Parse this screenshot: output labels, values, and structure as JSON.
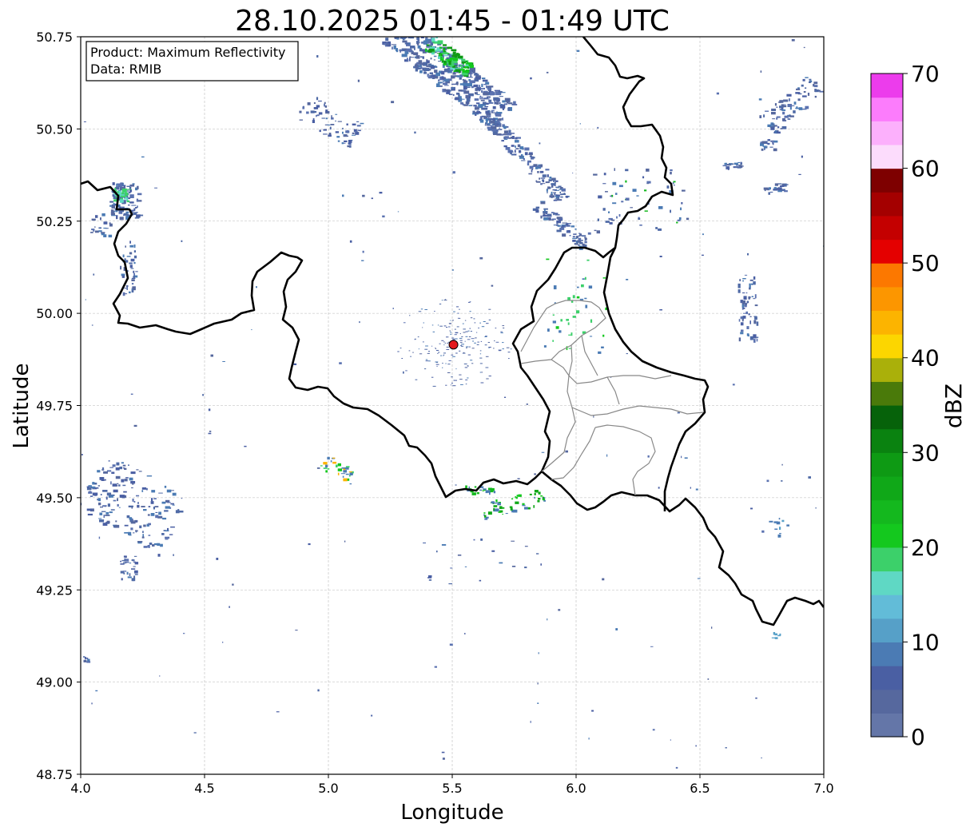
{
  "title": "28.10.2025 01:45 - 01:49 UTC",
  "info_box": {
    "line1": "Product: Maximum Reflectivity",
    "line2": "Data: RMIB"
  },
  "axes": {
    "xlabel": "Longitude",
    "ylabel": "Latitude",
    "xlim": [
      4.0,
      7.0
    ],
    "ylim": [
      48.75,
      50.75
    ],
    "x_ticks": [
      {
        "value": 4.0,
        "label": "4.0"
      },
      {
        "value": 4.5,
        "label": "4.5"
      },
      {
        "value": 5.0,
        "label": "5.0"
      },
      {
        "value": 5.5,
        "label": "5.5"
      },
      {
        "value": 6.0,
        "label": "6.0"
      },
      {
        "value": 6.5,
        "label": "6.5"
      },
      {
        "value": 7.0,
        "label": "7.0"
      }
    ],
    "y_ticks": [
      {
        "value": 48.75,
        "label": "48.75"
      },
      {
        "value": 49.0,
        "label": "49.00"
      },
      {
        "value": 49.25,
        "label": "49.25"
      },
      {
        "value": 49.5,
        "label": "49.50"
      },
      {
        "value": 49.75,
        "label": "49.75"
      },
      {
        "value": 50.0,
        "label": "50.00"
      },
      {
        "value": 50.25,
        "label": "50.25"
      },
      {
        "value": 50.5,
        "label": "50.50"
      },
      {
        "value": 50.75,
        "label": "50.75"
      }
    ],
    "grid": true
  },
  "radar_site": {
    "lon": 5.505,
    "lat": 49.915,
    "color": "#e41a1c"
  },
  "colorbar": {
    "label": "dBZ",
    "min": 0,
    "max": 70,
    "tick_labels": [
      {
        "value": 0,
        "label": "0"
      },
      {
        "value": 10,
        "label": "10"
      },
      {
        "value": 20,
        "label": "20"
      },
      {
        "value": 30,
        "label": "30"
      },
      {
        "value": 40,
        "label": "40"
      },
      {
        "value": 50,
        "label": "50"
      },
      {
        "value": 60,
        "label": "60"
      },
      {
        "value": 70,
        "label": "70"
      }
    ],
    "colors": [
      "#6476a8",
      "#56689e",
      "#4a5fa3",
      "#4b7bb4",
      "#56a0c8",
      "#62bcd8",
      "#5fd8c4",
      "#3cd06a",
      "#14c81e",
      "#14b81e",
      "#10a818",
      "#0e9a14",
      "#0a8210",
      "#06620a",
      "#4a7a0a",
      "#aab00a",
      "#fcd600",
      "#fcb400",
      "#fc9600",
      "#fc7800",
      "#e40000",
      "#c40000",
      "#a40000",
      "#7e0000",
      "#fcdcfc",
      "#fcb0fc",
      "#fc7cfc",
      "#ec3cec"
    ]
  },
  "chart_data": {
    "type": "map",
    "product": "Maximum Reflectivity",
    "source": "RMIB",
    "time_window": "28.10.2025 01:45 - 01:49 UTC",
    "radar_site": {
      "lon": 5.505,
      "lat": 49.915
    },
    "echo_areas": [
      {
        "name": "north-band",
        "lon": [
          5.35,
          5.65
        ],
        "lat": [
          50.45,
          50.75
        ],
        "max_dbz": 25
      },
      {
        "name": "west-cell",
        "lon": [
          4.1,
          4.25
        ],
        "lat": [
          50.15,
          50.35
        ],
        "max_dbz": 22
      },
      {
        "name": "southwest-cluster",
        "lon": [
          4.05,
          4.4
        ],
        "lat": [
          49.2,
          49.6
        ],
        "max_dbz": 8
      },
      {
        "name": "east-streaks",
        "lon": [
          6.6,
          7.0
        ],
        "lat": [
          49.8,
          50.65
        ],
        "max_dbz": 15
      }
    ],
    "xlim": [
      4.0,
      7.0
    ],
    "ylim": [
      48.75,
      50.75
    ]
  }
}
